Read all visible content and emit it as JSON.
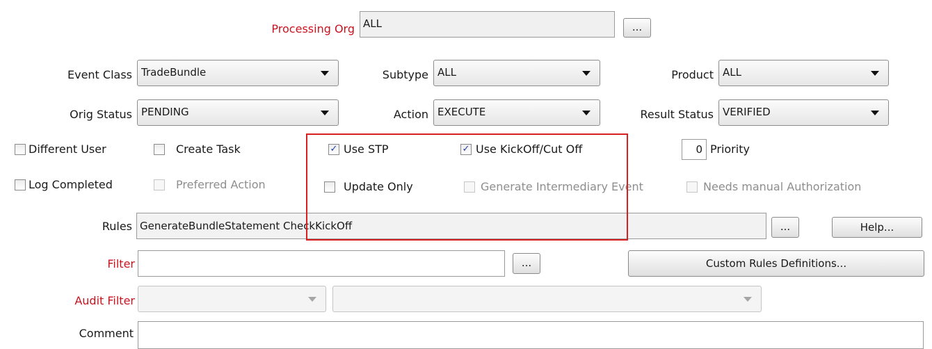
{
  "processing_org": {
    "label": "Processing Org",
    "value": "ALL",
    "button": "..."
  },
  "row1": {
    "event_class": {
      "label": "Event Class",
      "value": "TradeBundle"
    },
    "subtype": {
      "label": "Subtype",
      "value": "ALL"
    },
    "product": {
      "label": "Product",
      "value": "ALL"
    }
  },
  "row2": {
    "orig_status": {
      "label": "Orig Status",
      "value": "PENDING"
    },
    "action": {
      "label": "Action",
      "value": "EXECUTE"
    },
    "result_status": {
      "label": "Result Status",
      "value": "VERIFIED"
    }
  },
  "checkboxes": {
    "different_user": {
      "label": "Different User",
      "checked": false
    },
    "create_task": {
      "label": "Create Task",
      "checked": false
    },
    "use_stp": {
      "label": "Use STP",
      "checked": true
    },
    "use_kickoff": {
      "label": "Use KickOff/Cut Off",
      "checked": true
    },
    "log_completed": {
      "label": "Log Completed",
      "checked": false
    },
    "preferred_action": {
      "label": "Preferred Action",
      "checked": false,
      "disabled": true
    },
    "update_only": {
      "label": "Update Only",
      "checked": false
    },
    "generate_intermediary": {
      "label": "Generate Intermediary Event",
      "checked": false,
      "disabled": true
    },
    "needs_manual_auth": {
      "label": "Needs manual Authorization",
      "checked": false,
      "disabled": true
    }
  },
  "priority": {
    "value": "0",
    "label": "Priority"
  },
  "rules": {
    "label": "Rules",
    "value": "GenerateBundleStatement CheckKickOff",
    "button": "...",
    "help": "Help..."
  },
  "filter": {
    "label": "Filter",
    "value": "",
    "button": "...",
    "custom_rules": "Custom Rules Definitions..."
  },
  "audit_filter": {
    "label": "Audit Filter",
    "value": "",
    "second_value": ""
  },
  "comment": {
    "label": "Comment",
    "value": ""
  },
  "check_glyph": "✓",
  "colors": {
    "required_label": "#c8141e",
    "highlight_box": "#d82020"
  }
}
